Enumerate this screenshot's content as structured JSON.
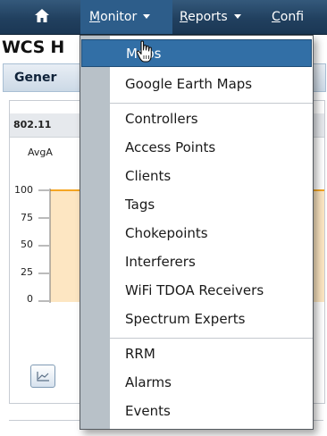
{
  "nav": {
    "home_icon": "home-icon",
    "items": [
      {
        "label_rest": "onitor",
        "underline": "M",
        "has_caret": true
      },
      {
        "label_rest": "eports",
        "underline": "R",
        "has_caret": true
      },
      {
        "label_rest": "onfi",
        "underline": "C",
        "has_caret": false
      }
    ],
    "colors": {
      "bar": "#21405f",
      "active": "#2d5d8a"
    }
  },
  "page": {
    "title": "WCS H",
    "tab_label": "Gener",
    "dashlet_title": "802.11",
    "dashlet_sub": "AvgA",
    "y_ticks": [
      "100",
      "75",
      "50",
      "25",
      "0"
    ],
    "chart_button_icon": "line-chart-icon"
  },
  "menu": {
    "items": [
      {
        "label": "Maps",
        "highlighted": true
      },
      {
        "label": "Google Earth Maps"
      },
      {
        "label": "Controllers"
      },
      {
        "label": "Access Points"
      },
      {
        "label": "Clients"
      },
      {
        "label": "Tags"
      },
      {
        "label": "Chokepoints"
      },
      {
        "label": "Interferers"
      },
      {
        "label": "WiFi TDOA Receivers"
      },
      {
        "label": "Spectrum Experts"
      },
      {
        "label": "RRM"
      },
      {
        "label": "Alarms"
      },
      {
        "label": "Events"
      }
    ],
    "highlight_color": "#326fa6",
    "cursor_icon": "hand-pointer-icon"
  }
}
